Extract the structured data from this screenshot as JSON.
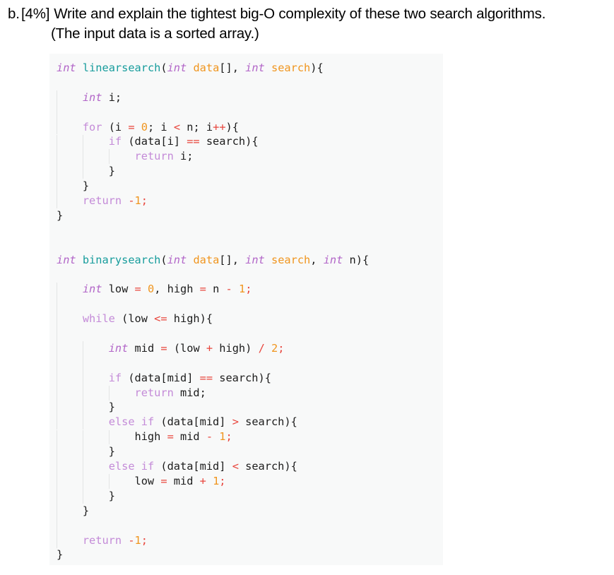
{
  "question": {
    "marker": "b.",
    "points": "[4%]",
    "text": "Write and explain the tightest big-O complexity of these two search algorithms.",
    "subtext": "(The input data is a sorted array.)"
  },
  "colors": {
    "code_background": "#f8f9f9",
    "page_background": "#ffffff",
    "type_keyword": "#b266c8",
    "control_keyword": "#c48bd8",
    "function_name": "#169c9c",
    "parameter": "#f0951e",
    "number": "#f0951e",
    "operator": "#e8453c",
    "plain_text": "#1c1c1c",
    "indent_guide": "#e3e5e5"
  },
  "code_block": {
    "language": "c",
    "lines": [
      {
        "indent": 0,
        "tokens": [
          {
            "t": "int",
            "c": "type"
          },
          {
            "t": " ",
            "c": "plain"
          },
          {
            "t": "linearsearch",
            "c": "func"
          },
          {
            "t": "(",
            "c": "punct"
          },
          {
            "t": "int",
            "c": "type"
          },
          {
            "t": " ",
            "c": "plain"
          },
          {
            "t": "data",
            "c": "param"
          },
          {
            "t": "[], ",
            "c": "punct"
          },
          {
            "t": "int",
            "c": "type"
          },
          {
            "t": " ",
            "c": "plain"
          },
          {
            "t": "search",
            "c": "param"
          },
          {
            "t": "){",
            "c": "punct"
          }
        ]
      },
      {
        "indent": 0,
        "tokens": []
      },
      {
        "indent": 1,
        "tokens": [
          {
            "t": "int",
            "c": "type"
          },
          {
            "t": " i;",
            "c": "plain"
          }
        ]
      },
      {
        "indent": 1,
        "tokens": []
      },
      {
        "indent": 1,
        "tokens": [
          {
            "t": "for",
            "c": "keyword"
          },
          {
            "t": " (i ",
            "c": "plain"
          },
          {
            "t": "=",
            "c": "operator"
          },
          {
            "t": " ",
            "c": "plain"
          },
          {
            "t": "0",
            "c": "number"
          },
          {
            "t": "; i ",
            "c": "plain"
          },
          {
            "t": "<",
            "c": "operator"
          },
          {
            "t": " n; i",
            "c": "plain"
          },
          {
            "t": "++",
            "c": "operator"
          },
          {
            "t": "){",
            "c": "punct"
          }
        ]
      },
      {
        "indent": 2,
        "tokens": [
          {
            "t": "if",
            "c": "keyword"
          },
          {
            "t": " (data[i] ",
            "c": "plain"
          },
          {
            "t": "==",
            "c": "operator"
          },
          {
            "t": " search){",
            "c": "plain"
          }
        ]
      },
      {
        "indent": 3,
        "tokens": [
          {
            "t": "return",
            "c": "keyword"
          },
          {
            "t": " i;",
            "c": "plain"
          }
        ]
      },
      {
        "indent": 2,
        "tokens": [
          {
            "t": "}",
            "c": "punct"
          }
        ]
      },
      {
        "indent": 1,
        "tokens": [
          {
            "t": "}",
            "c": "punct"
          }
        ]
      },
      {
        "indent": 1,
        "tokens": [
          {
            "t": "return",
            "c": "keyword"
          },
          {
            "t": " ",
            "c": "plain"
          },
          {
            "t": "-",
            "c": "operator"
          },
          {
            "t": "1",
            "c": "number"
          },
          {
            "t": ";",
            "c": "operator"
          }
        ]
      },
      {
        "indent": 0,
        "tokens": [
          {
            "t": "}",
            "c": "punct"
          }
        ]
      },
      {
        "indent": 0,
        "tokens": []
      },
      {
        "indent": 0,
        "tokens": []
      },
      {
        "indent": 0,
        "tokens": [
          {
            "t": "int",
            "c": "type"
          },
          {
            "t": " ",
            "c": "plain"
          },
          {
            "t": "binarysearch",
            "c": "func"
          },
          {
            "t": "(",
            "c": "punct"
          },
          {
            "t": "int",
            "c": "type"
          },
          {
            "t": " ",
            "c": "plain"
          },
          {
            "t": "data",
            "c": "param"
          },
          {
            "t": "[], ",
            "c": "punct"
          },
          {
            "t": "int",
            "c": "type"
          },
          {
            "t": " ",
            "c": "plain"
          },
          {
            "t": "search",
            "c": "param"
          },
          {
            "t": ", ",
            "c": "punct"
          },
          {
            "t": "int",
            "c": "type"
          },
          {
            "t": " n){",
            "c": "plain"
          }
        ]
      },
      {
        "indent": 0,
        "tokens": []
      },
      {
        "indent": 1,
        "tokens": [
          {
            "t": "int",
            "c": "type"
          },
          {
            "t": " low ",
            "c": "plain"
          },
          {
            "t": "=",
            "c": "operator"
          },
          {
            "t": " ",
            "c": "plain"
          },
          {
            "t": "0",
            "c": "number"
          },
          {
            "t": ", high ",
            "c": "plain"
          },
          {
            "t": "=",
            "c": "operator"
          },
          {
            "t": " n ",
            "c": "plain"
          },
          {
            "t": "-",
            "c": "operator"
          },
          {
            "t": " ",
            "c": "plain"
          },
          {
            "t": "1",
            "c": "number"
          },
          {
            "t": ";",
            "c": "operator"
          }
        ]
      },
      {
        "indent": 1,
        "tokens": []
      },
      {
        "indent": 1,
        "tokens": [
          {
            "t": "while",
            "c": "keyword"
          },
          {
            "t": " (low ",
            "c": "plain"
          },
          {
            "t": "<=",
            "c": "operator"
          },
          {
            "t": " high){",
            "c": "plain"
          }
        ]
      },
      {
        "indent": 2,
        "tokens": []
      },
      {
        "indent": 2,
        "tokens": [
          {
            "t": "int",
            "c": "type"
          },
          {
            "t": " mid ",
            "c": "plain"
          },
          {
            "t": "=",
            "c": "operator"
          },
          {
            "t": " (low ",
            "c": "plain"
          },
          {
            "t": "+",
            "c": "operator"
          },
          {
            "t": " high) ",
            "c": "plain"
          },
          {
            "t": "/",
            "c": "operator"
          },
          {
            "t": " ",
            "c": "plain"
          },
          {
            "t": "2",
            "c": "number"
          },
          {
            "t": ";",
            "c": "operator"
          }
        ]
      },
      {
        "indent": 2,
        "tokens": []
      },
      {
        "indent": 2,
        "tokens": [
          {
            "t": "if",
            "c": "keyword"
          },
          {
            "t": " (data[mid] ",
            "c": "plain"
          },
          {
            "t": "==",
            "c": "operator"
          },
          {
            "t": " search){",
            "c": "plain"
          }
        ]
      },
      {
        "indent": 3,
        "tokens": [
          {
            "t": "return",
            "c": "keyword"
          },
          {
            "t": " mid;",
            "c": "plain"
          }
        ]
      },
      {
        "indent": 2,
        "tokens": [
          {
            "t": "}",
            "c": "punct"
          }
        ]
      },
      {
        "indent": 2,
        "tokens": [
          {
            "t": "else",
            "c": "keyword"
          },
          {
            "t": " ",
            "c": "plain"
          },
          {
            "t": "if",
            "c": "keyword"
          },
          {
            "t": " (data[mid] ",
            "c": "plain"
          },
          {
            "t": ">",
            "c": "operator"
          },
          {
            "t": " search){",
            "c": "plain"
          }
        ]
      },
      {
        "indent": 3,
        "tokens": [
          {
            "t": "high ",
            "c": "plain"
          },
          {
            "t": "=",
            "c": "operator"
          },
          {
            "t": " mid ",
            "c": "plain"
          },
          {
            "t": "-",
            "c": "operator"
          },
          {
            "t": " ",
            "c": "plain"
          },
          {
            "t": "1",
            "c": "number"
          },
          {
            "t": ";",
            "c": "operator"
          }
        ]
      },
      {
        "indent": 2,
        "tokens": [
          {
            "t": "}",
            "c": "punct"
          }
        ]
      },
      {
        "indent": 2,
        "tokens": [
          {
            "t": "else",
            "c": "keyword"
          },
          {
            "t": " ",
            "c": "plain"
          },
          {
            "t": "if",
            "c": "keyword"
          },
          {
            "t": " (data[mid] ",
            "c": "plain"
          },
          {
            "t": "<",
            "c": "operator"
          },
          {
            "t": " search){",
            "c": "plain"
          }
        ]
      },
      {
        "indent": 3,
        "tokens": [
          {
            "t": "low ",
            "c": "plain"
          },
          {
            "t": "=",
            "c": "operator"
          },
          {
            "t": " mid ",
            "c": "plain"
          },
          {
            "t": "+",
            "c": "operator"
          },
          {
            "t": " ",
            "c": "plain"
          },
          {
            "t": "1",
            "c": "number"
          },
          {
            "t": ";",
            "c": "operator"
          }
        ]
      },
      {
        "indent": 2,
        "tokens": [
          {
            "t": "}",
            "c": "punct"
          }
        ]
      },
      {
        "indent": 1,
        "tokens": [
          {
            "t": "}",
            "c": "punct"
          }
        ]
      },
      {
        "indent": 1,
        "tokens": []
      },
      {
        "indent": 1,
        "tokens": [
          {
            "t": "return",
            "c": "keyword"
          },
          {
            "t": " ",
            "c": "plain"
          },
          {
            "t": "-",
            "c": "operator"
          },
          {
            "t": "1",
            "c": "number"
          },
          {
            "t": ";",
            "c": "operator"
          }
        ]
      },
      {
        "indent": 0,
        "tokens": [
          {
            "t": "}",
            "c": "punct"
          }
        ]
      }
    ]
  }
}
